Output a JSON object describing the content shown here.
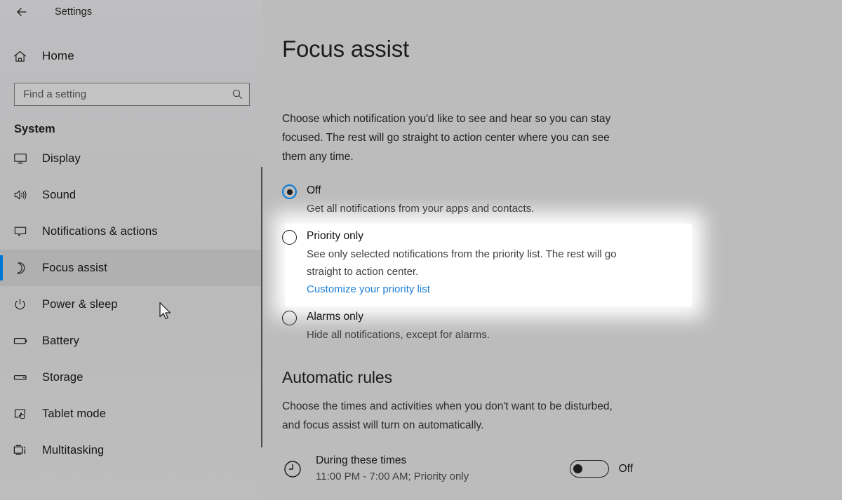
{
  "window": {
    "back_icon": "back-arrow-icon",
    "title": "Settings"
  },
  "sidebar": {
    "home": {
      "label": "Home",
      "icon": "home-icon"
    },
    "search": {
      "placeholder": "Find a setting",
      "value": "",
      "icon": "search-icon"
    },
    "section_heading": "System",
    "items": [
      {
        "label": "Display",
        "icon": "monitor-icon",
        "selected": false
      },
      {
        "label": "Sound",
        "icon": "speaker-icon",
        "selected": false
      },
      {
        "label": "Notifications & actions",
        "icon": "chat-bubble-icon",
        "selected": false
      },
      {
        "label": "Focus assist",
        "icon": "moon-icon",
        "selected": true
      },
      {
        "label": "Power & sleep",
        "icon": "power-icon",
        "selected": false
      },
      {
        "label": "Battery",
        "icon": "battery-icon",
        "selected": false
      },
      {
        "label": "Storage",
        "icon": "drive-icon",
        "selected": false
      },
      {
        "label": "Tablet mode",
        "icon": "tablet-hand-icon",
        "selected": false
      },
      {
        "label": "Multitasking",
        "icon": "multitasking-icon",
        "selected": false
      }
    ]
  },
  "main": {
    "title": "Focus assist",
    "description": "Choose which notification you'd like to see and hear so you can stay focused. The rest will go straight to action center where you can see them any time.",
    "options": [
      {
        "label": "Off",
        "sub": "Get all notifications from your apps and contacts.",
        "checked": true,
        "link": ""
      },
      {
        "label": "Priority only",
        "sub": "See only selected notifications from the priority list. The rest will go straight to action center.",
        "checked": false,
        "link": "Customize your priority list"
      },
      {
        "label": "Alarms only",
        "sub": "Hide all notifications, except for alarms.",
        "checked": false,
        "link": ""
      }
    ],
    "automatic_rules": {
      "title": "Automatic rules",
      "description": "Choose the times and activities when you don't want to be disturbed, and focus assist will turn on automatically.",
      "rules": [
        {
          "icon": "clock-icon",
          "name": "During these times",
          "detail": "11:00 PM - 7:00 AM; Priority only",
          "toggle_state": "Off",
          "toggle_on": false
        }
      ]
    }
  },
  "colors": {
    "accent": "#0078d7",
    "link": "#1e7fd4",
    "background": "#bcbcbc",
    "selected_row": "#b0b0b0"
  }
}
